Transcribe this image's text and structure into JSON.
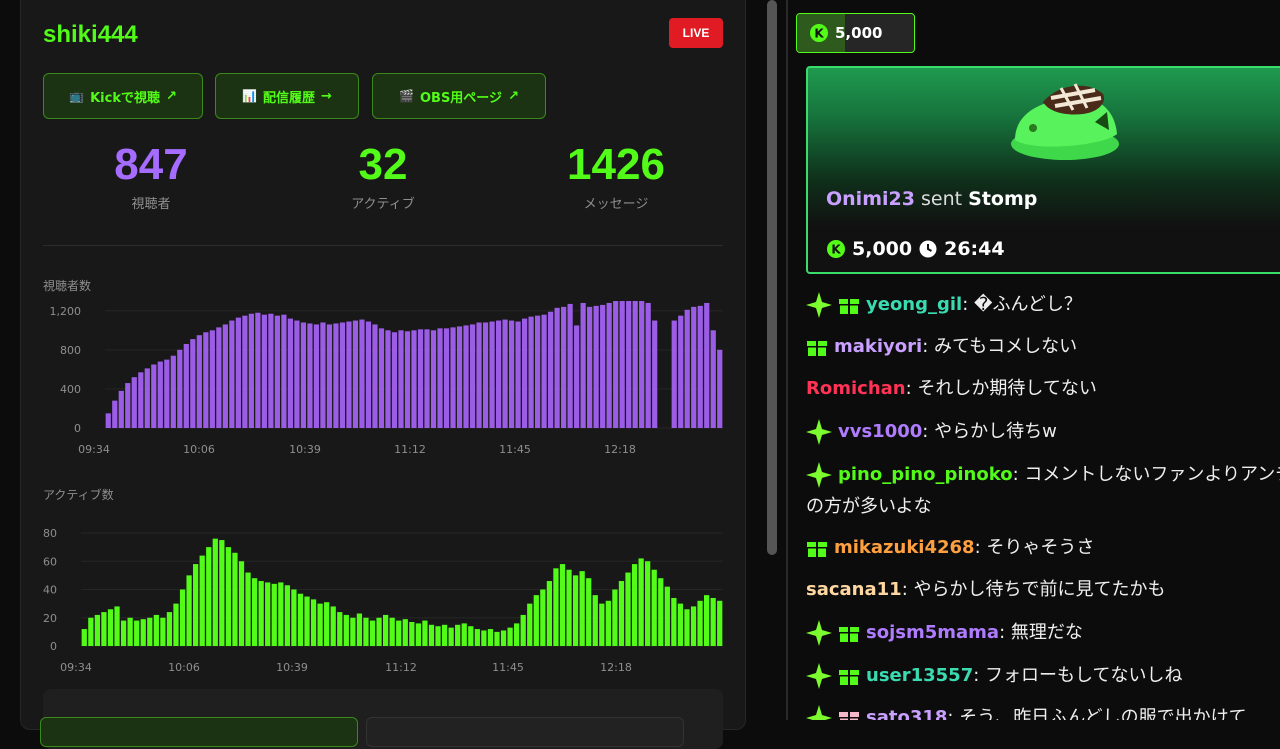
{
  "channel": {
    "name": "shiki444",
    "live_label": "LIVE"
  },
  "links": [
    {
      "icon": "📺",
      "label": "Kickで視聴",
      "arrow": "↗"
    },
    {
      "icon": "📊",
      "label": "配信履歴",
      "arrow": "→"
    },
    {
      "icon": "🎬",
      "label": "OBS用ページ",
      "arrow": "↗"
    }
  ],
  "stats": [
    {
      "value": "847",
      "label": "視聴者",
      "color": "#a66cff"
    },
    {
      "value": "32",
      "label": "アクティブ",
      "color": "#53fc18"
    },
    {
      "value": "1426",
      "label": "メッセージ",
      "color": "#53fc18"
    }
  ],
  "chart_data": [
    {
      "type": "bar",
      "title": "視聴者数",
      "color": "#9b5de5",
      "ylim": [
        0,
        1300
      ],
      "yticks": [
        "0",
        "400",
        "800",
        "1,200"
      ],
      "xticks": [
        "09:34",
        "10:06",
        "10:39",
        "11:12",
        "11:45",
        "12:18"
      ],
      "series": [
        {
          "values": [
            150,
            280,
            380,
            460,
            520,
            570,
            610,
            650,
            680,
            700,
            740,
            800,
            860,
            910,
            950,
            980,
            1000,
            1030,
            1060,
            1100,
            1130,
            1150,
            1170,
            1180,
            1160,
            1170,
            1150,
            1160,
            1120,
            1100,
            1080,
            1070,
            1060,
            1080,
            1060,
            1070,
            1080,
            1090,
            1100,
            1110,
            1090,
            1060,
            1020,
            1000,
            980,
            1000,
            990,
            1000,
            1010,
            1010,
            1000,
            1020,
            1020,
            1030,
            1040,
            1050,
            1060,
            1080,
            1080,
            1090,
            1100,
            1110,
            1100,
            1090,
            1120,
            1140,
            1150,
            1160,
            1190,
            1230,
            1240,
            1270,
            1050,
            1280,
            1240,
            1250,
            1260,
            1280,
            1300,
            1310,
            1320,
            1320,
            1310,
            1280,
            1100,
            0,
            0,
            1100,
            1150,
            1210,
            1240,
            1250,
            1280,
            1000,
            800
          ]
        }
      ]
    },
    {
      "type": "bar",
      "title": "アクティブ数",
      "color": "#53fc18",
      "ylim": [
        0,
        80
      ],
      "yticks": [
        "0",
        "20",
        "40",
        "60",
        "80"
      ],
      "xticks": [
        "09:34",
        "10:06",
        "10:39",
        "11:12",
        "11:45",
        "12:18"
      ],
      "series": [
        {
          "values": [
            12,
            20,
            22,
            24,
            26,
            28,
            18,
            20,
            18,
            19,
            20,
            22,
            20,
            24,
            30,
            40,
            50,
            58,
            64,
            70,
            76,
            75,
            70,
            66,
            60,
            52,
            48,
            46,
            45,
            44,
            45,
            43,
            40,
            37,
            35,
            33,
            30,
            31,
            28,
            24,
            22,
            20,
            23,
            20,
            18,
            20,
            22,
            20,
            18,
            19,
            17,
            16,
            18,
            15,
            14,
            15,
            13,
            15,
            16,
            14,
            12,
            11,
            12,
            10,
            11,
            13,
            16,
            22,
            30,
            36,
            40,
            46,
            55,
            58,
            54,
            50,
            53,
            48,
            36,
            30,
            32,
            40,
            46,
            52,
            58,
            62,
            60,
            54,
            48,
            42,
            34,
            30,
            26,
            28,
            32,
            36,
            34,
            32
          ]
        }
      ]
    }
  ],
  "chat": {
    "pinned_amount": "5,000",
    "gift": {
      "sender": "Onimi23",
      "verb": "sent",
      "item": "Stomp",
      "amount": "5,000",
      "timer": "26:44"
    },
    "messages": [
      {
        "user": "yeong_gil",
        "color": "#3adbb0",
        "text": ": �ふんどし？",
        "badges": [
          "sparkle",
          "gift"
        ]
      },
      {
        "user": "makiyori",
        "color": "#c9a0ff",
        "text": ": みてもコメしない",
        "badges": [
          "gift"
        ]
      },
      {
        "user": "Romichan",
        "color": "#ff3355",
        "text": ": それしか期待してない",
        "badges": []
      },
      {
        "user": "vvs1000",
        "color": "#b07cff",
        "text": ": やらかし待ちw",
        "badges": [
          "sparkle"
        ]
      },
      {
        "user": "pino_pino_pinoko",
        "color": "#53fc18",
        "text": ": コメントしないファンよりアンチの方が多いよな",
        "badges": [
          "sparkle"
        ]
      },
      {
        "user": "mikazuki4268",
        "color": "#ffa040",
        "text": ": そりゃそうさ",
        "badges": [
          "gift"
        ]
      },
      {
        "user": "sacana11",
        "color": "#ffd7a0",
        "text": ": やらかし待ちで前に見てたかも",
        "badges": []
      },
      {
        "user": "sojsm5mama",
        "color": "#b07cff",
        "text": ": 無理だな",
        "badges": [
          "sparkle",
          "gift"
        ]
      },
      {
        "user": "user13557",
        "color": "#3adbb0",
        "text": ": フォローもしてないしね",
        "badges": [
          "sparkle",
          "gift"
        ]
      },
      {
        "user": "sato318",
        "color": "#c9a0ff",
        "text": ": そう、昨日ふんどしの服で出かけて",
        "badges": [
          "sparkle",
          "gift-pink"
        ]
      }
    ]
  }
}
